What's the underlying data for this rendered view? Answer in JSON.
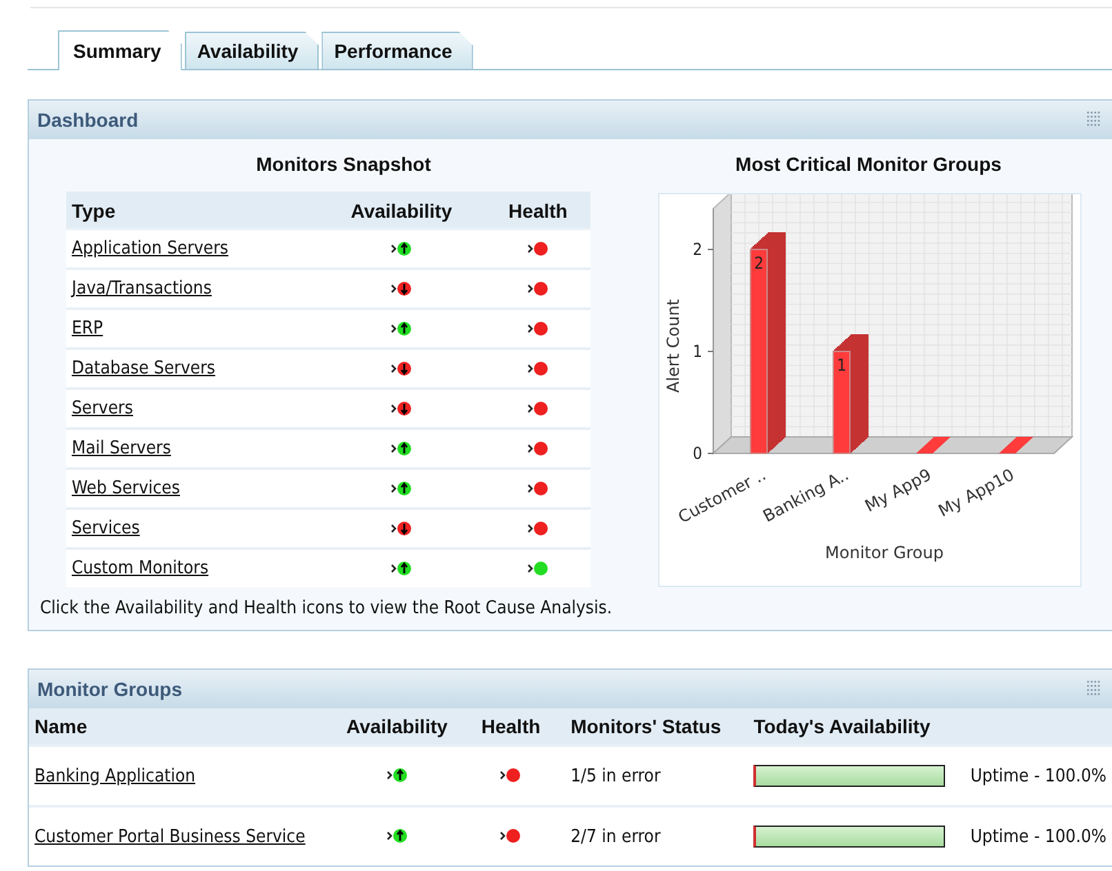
{
  "tabs": [
    {
      "label": "Summary",
      "selected": true
    },
    {
      "label": "Availability",
      "selected": false
    },
    {
      "label": "Performance",
      "selected": false
    }
  ],
  "dashboard": {
    "title": "Dashboard",
    "snapshot": {
      "title": "Monitors Snapshot",
      "columns": [
        "Type",
        "Availability",
        "Health"
      ],
      "rows": [
        {
          "type": "Application Servers",
          "up": true,
          "healthy": false
        },
        {
          "type": "Java/Transactions",
          "up": false,
          "healthy": false
        },
        {
          "type": "ERP",
          "up": true,
          "healthy": false
        },
        {
          "type": "Database Servers",
          "up": false,
          "healthy": false
        },
        {
          "type": "Servers",
          "up": false,
          "healthy": false
        },
        {
          "type": "Mail Servers",
          "up": true,
          "healthy": false
        },
        {
          "type": "Web Services",
          "up": true,
          "healthy": false
        },
        {
          "type": "Services",
          "up": false,
          "healthy": false
        },
        {
          "type": "Custom Monitors",
          "up": true,
          "healthy": true
        }
      ],
      "note": "Click the Availability and Health icons to view the Root Cause Analysis."
    },
    "critical": {
      "title": "Most Critical Monitor Groups",
      "chart_data": {
        "type": "bar",
        "xlabel": "Monitor Group",
        "ylabel": "Alert Count",
        "categories": [
          "Customer ..",
          "Banking A..",
          "My App9",
          "My App10"
        ],
        "series": [
          {
            "color": "#ff3b3b",
            "values": [
              2,
              1,
              0,
              0
            ]
          }
        ],
        "yticks": [
          0,
          1,
          2
        ],
        "ylim": [
          0,
          2.4
        ],
        "grid": true,
        "value_labels": [
          "2",
          "1",
          null,
          null
        ]
      }
    }
  },
  "monitor_groups": {
    "title": "Monitor Groups",
    "columns": [
      "Name",
      "Availability",
      "Health",
      "Monitors' Status",
      "Today's Availability"
    ],
    "rows": [
      {
        "name": "Banking Application",
        "up": true,
        "healthy": false,
        "status": "1/5 in error",
        "level": 1.0,
        "uptime": "Uptime - 100.0%"
      },
      {
        "name": "Customer Portal Business Service",
        "up": true,
        "healthy": false,
        "status": "2/7 in error",
        "level": 1.0,
        "uptime": "Uptime - 100.0%"
      }
    ]
  }
}
